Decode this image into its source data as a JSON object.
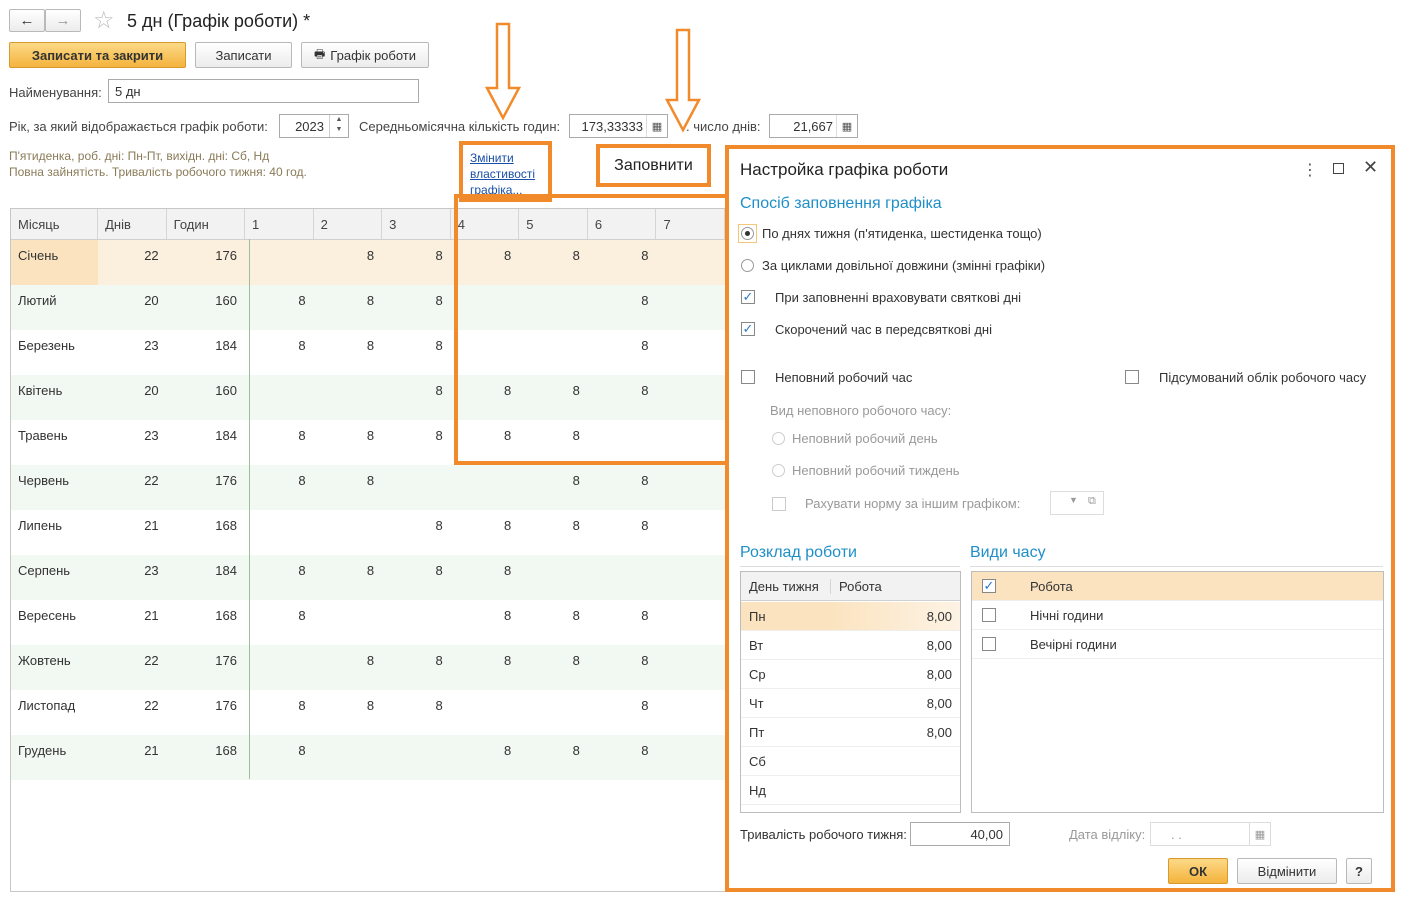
{
  "window": {
    "title": "5 дн (Графік роботи) *"
  },
  "toolbar": {
    "save_close": "Записати та закрити",
    "save": "Записати",
    "schedule": "Графік роботи"
  },
  "form": {
    "name_label": "Найменування:",
    "name_value": "5 дн",
    "year_label": "Рік, за який відображається графік роботи:",
    "year_value": "2023",
    "avg_hours_label": "Середньомісячна кількість годин:",
    "avg_hours_value": "173,33333",
    "avg_days_label": ". число днів:",
    "avg_days_value": "21,667",
    "info_line1": "П'ятиденка, роб. дні: Пн-Пт, вихідн. дні: Сб, Нд",
    "info_line2": "Повна зайнятість. Тривалість робочого тижня: 40 год.",
    "change_link": "Змінити властивості графіка...",
    "fill_button": "Заповнити"
  },
  "grid": {
    "headers": [
      "Місяць",
      "Днів",
      "Годин",
      "1",
      "2",
      "3",
      "4",
      "5",
      "6",
      "7"
    ],
    "rows": [
      {
        "month": "Січень",
        "days": "22",
        "hours": "176",
        "d": [
          "",
          "8",
          "8",
          "8",
          "8",
          "8",
          ""
        ]
      },
      {
        "month": "Лютий",
        "days": "20",
        "hours": "160",
        "d": [
          "8",
          "8",
          "8",
          "",
          "",
          "8",
          ""
        ]
      },
      {
        "month": "Березень",
        "days": "23",
        "hours": "184",
        "d": [
          "8",
          "8",
          "8",
          "",
          "",
          "8",
          ""
        ]
      },
      {
        "month": "Квітень",
        "days": "20",
        "hours": "160",
        "d": [
          "",
          "",
          "8",
          "8",
          "8",
          "8",
          ""
        ]
      },
      {
        "month": "Травень",
        "days": "23",
        "hours": "184",
        "d": [
          "8",
          "8",
          "8",
          "8",
          "8",
          "",
          ""
        ]
      },
      {
        "month": "Червень",
        "days": "22",
        "hours": "176",
        "d": [
          "8",
          "8",
          "",
          "",
          "8",
          "8",
          ""
        ]
      },
      {
        "month": "Липень",
        "days": "21",
        "hours": "168",
        "d": [
          "",
          "",
          "8",
          "8",
          "8",
          "8",
          ""
        ]
      },
      {
        "month": "Серпень",
        "days": "23",
        "hours": "184",
        "d": [
          "8",
          "8",
          "8",
          "8",
          "",
          "",
          ""
        ]
      },
      {
        "month": "Вересень",
        "days": "21",
        "hours": "168",
        "d": [
          "8",
          "",
          "",
          "8",
          "8",
          "8",
          ""
        ]
      },
      {
        "month": "Жовтень",
        "days": "22",
        "hours": "176",
        "d": [
          "",
          "8",
          "8",
          "8",
          "8",
          "8",
          ""
        ]
      },
      {
        "month": "Листопад",
        "days": "22",
        "hours": "176",
        "d": [
          "8",
          "8",
          "8",
          "",
          "",
          "8",
          ""
        ]
      },
      {
        "month": "Грудень",
        "days": "21",
        "hours": "168",
        "d": [
          "8",
          "",
          "",
          "8",
          "8",
          "8",
          ""
        ]
      }
    ]
  },
  "dialog": {
    "title": "Настройка графіка роботи",
    "fill_method_header": "Спосіб заповнення графіка",
    "radio_weekdays": "По днях тижня (п'ятиденка, шестиденка тощо)",
    "radio_cycles": "За циклами довільної довжини (змінні графіки)",
    "chk_holidays": "При заповненні враховувати святкові дні",
    "chk_preholiday": "Скорочений час в передсвяткові дні",
    "chk_parttime": "Неповний робочий час",
    "chk_summary": "Підсумований облік робочого часу",
    "parttime_kind_label": "Вид неповного робочого часу:",
    "radio_partday": "Неповний робочий день",
    "radio_partweek": "Неповний робочий тиждень",
    "chk_other_norm": "Рахувати норму за іншим графіком:",
    "schedule_header": "Розклад роботи",
    "schedule_cols": [
      "День тижня",
      "Робота"
    ],
    "schedule_rows": [
      {
        "day": "Пн",
        "work": "8,00"
      },
      {
        "day": "Вт",
        "work": "8,00"
      },
      {
        "day": "Ср",
        "work": "8,00"
      },
      {
        "day": "Чт",
        "work": "8,00"
      },
      {
        "day": "Пт",
        "work": "8,00"
      },
      {
        "day": "Сб",
        "work": ""
      },
      {
        "day": "Нд",
        "work": ""
      }
    ],
    "time_types_header": "Види часу",
    "time_types": [
      {
        "label": "Робота",
        "checked": true
      },
      {
        "label": "Нічні години",
        "checked": false
      },
      {
        "label": "Вечірні години",
        "checked": false
      }
    ],
    "week_length_label": "Тривалість робочого тижня:",
    "week_length_value": "40,00",
    "ref_date_label": "Дата відліку:",
    "ref_date_value": ".  .",
    "ok": "ОК",
    "cancel": "Відмінити",
    "help": "?"
  },
  "colors": {
    "accent_orange": "#f08a2a",
    "section_blue": "#1f8fc8",
    "row_selected": "#fbe3c0",
    "row_alt_green": "#f2f8f2"
  }
}
